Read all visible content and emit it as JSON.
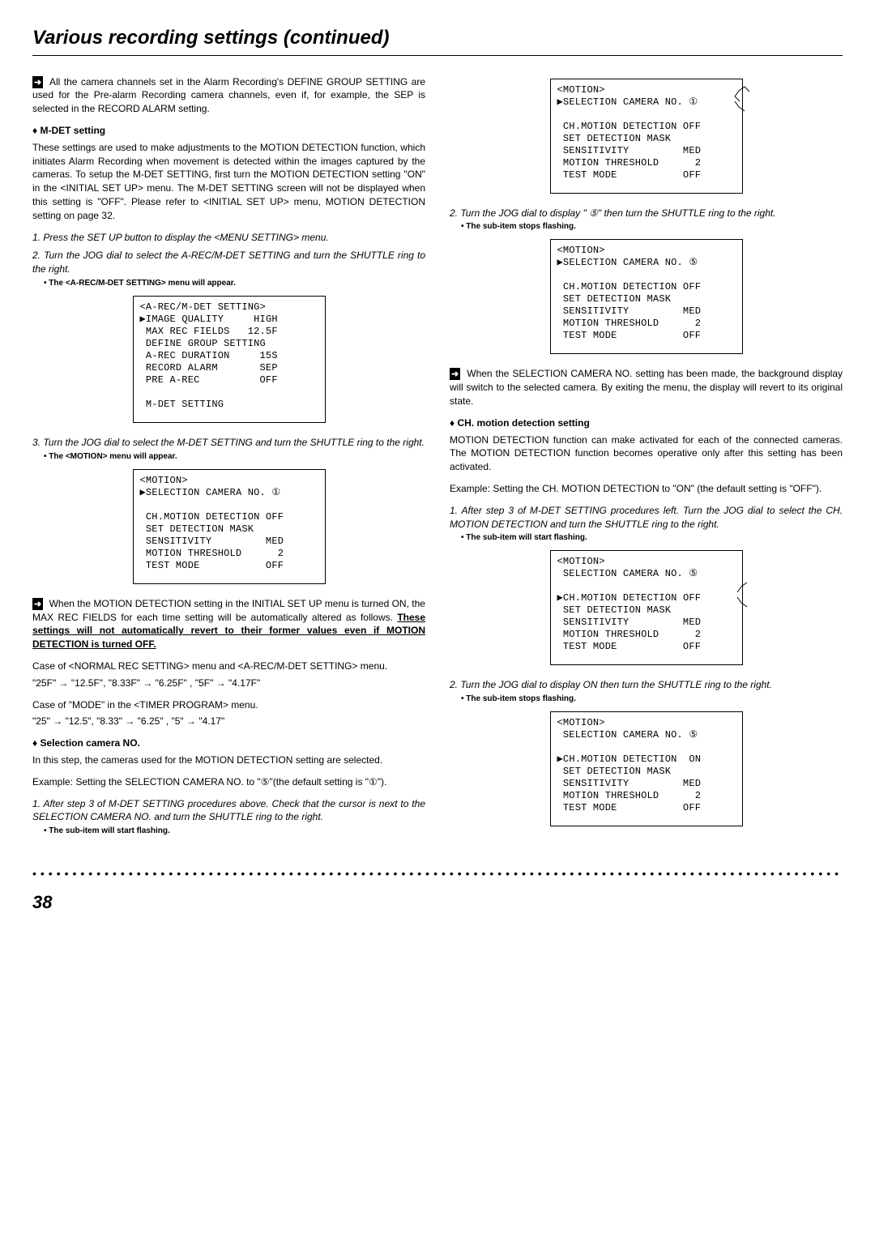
{
  "page_title": "Various recording settings (continued)",
  "page_number": "38",
  "left": {
    "notice1": "All the camera channels set in the Alarm Recording's DEFINE GROUP SETTING are used for the Pre-alarm Recording camera channels, even if, for example, the SEP is selected in the RECORD ALARM setting.",
    "h_mdet": "M-DET setting",
    "mdet_body": "These settings are used to make adjustments to the MOTION DETECTION function, which initiates Alarm Recording when movement is detected within the images captured by the cameras. To setup the M-DET SETTING, first turn the MOTION DETECTION setting \"ON\" in the <INITIAL SET UP> menu. The M-DET SETTING screen will not be displayed when this setting is \"OFF\". Please refer to <INITIAL SET UP> menu, MOTION DETECTION setting on page 32.",
    "step1": "1. Press the SET UP button to display the <MENU SETTING> menu.",
    "step2": "2. Turn the JOG dial to select the A-REC/M-DET SETTING and turn the SHUTTLE ring to the right.",
    "note2": "• The <A-REC/M-DET SETTING> menu will appear.",
    "screen1": "<A-REC/M-DET SETTING>\n▶IMAGE QUALITY     HIGH\n MAX REC FIELDS   12.5F\n DEFINE GROUP SETTING\n A-REC DURATION     15S\n RECORD ALARM       SEP\n PRE A-REC          OFF\n\n M-DET SETTING",
    "step3": "3. Turn the JOG dial to select the M-DET SETTING and turn the SHUTTLE ring to the right.",
    "note3": "• The <MOTION> menu will appear.",
    "screen2": "<MOTION>\n▶SELECTION CAMERA NO. ①\n\n CH.MOTION DETECTION OFF\n SET DETECTION MASK\n SENSITIVITY         MED\n MOTION THRESHOLD      2\n TEST MODE           OFF",
    "notice2_p1": "When the MOTION DETECTION setting in the INITIAL SET UP menu is turned ON, the MAX REC FIELDS for each time setting will be automatically altered as follows. ",
    "notice2_bold": "These settings will not automatically revert to their former values even if MOTION DETECTION is turned OFF.",
    "case1_title": "Case of <NORMAL REC SETTING> menu and <A-REC/M-DET SETTING> menu.",
    "case1_vals": "\"25F\" → \"12.5F\", \"8.33F\" → \"6.25F\" , \"5F\" → \"4.17F\"",
    "case2_title": "Case of \"MODE\" in the <TIMER PROGRAM> menu.",
    "case2_vals": "\"25\" → \"12.5\", \"8.33\" → \"6.25\" , \"5\" → \"4.17\"",
    "h_selcam": "Selection camera NO.",
    "selcam_body": "In this step, the cameras used for the MOTION DETECTION setting are selected.",
    "selcam_example": "Example: Setting the SELECTION CAMERA NO. to \"⑤\"(the default setting is \"①\").",
    "selcam_step1": "1. After step 3 of M-DET SETTING procedures above. Check that the cursor is next to the SELECTION CAMERA NO. and turn the SHUTTLE ring to the right.",
    "selcam_note1": "• The sub-item will start flashing."
  },
  "right": {
    "screen1": "<MOTION>\n▶SELECTION CAMERA NO. ①\n\n CH.MOTION DETECTION OFF\n SET DETECTION MASK\n SENSITIVITY         MED\n MOTION THRESHOLD      2\n TEST MODE           OFF",
    "step2": "2. Turn the JOG dial to display \" ⑤\" then turn the SHUTTLE ring to the right.",
    "note2": "• The sub-item stops flashing.",
    "screen2": "<MOTION>\n▶SELECTION CAMERA NO. ⑤\n\n CH.MOTION DETECTION OFF\n SET DETECTION MASK\n SENSITIVITY         MED\n MOTION THRESHOLD      2\n TEST MODE           OFF",
    "notice1": "When the SELECTION CAMERA NO. setting has been made, the background display will switch to the selected camera. By exiting the menu, the display will revert to its original state.",
    "h_chmot": "CH. motion detection setting",
    "chmot_body": "MOTION DETECTION function can make activated for each of the connected cameras. The MOTION DETECTION function becomes operative only after this setting has been activated.",
    "chmot_example": "Example: Setting the CH. MOTION DETECTION  to \"ON\" (the default setting is \"OFF\").",
    "chmot_step1": "1. After step 3 of M-DET SETTING procedures left. Turn the JOG dial to select the CH. MOTION DETECTION and turn the SHUTTLE ring to the right.",
    "chmot_note1": "• The sub-item will start flashing.",
    "screen3": "<MOTION>\n SELECTION CAMERA NO. ⑤\n\n▶CH.MOTION DETECTION OFF\n SET DETECTION MASK\n SENSITIVITY         MED\n MOTION THRESHOLD      2\n TEST MODE           OFF",
    "chmot_step2": "2. Turn the JOG dial to display ON then turn the SHUTTLE ring to the right.",
    "chmot_note2": "• The sub-item stops flashing.",
    "screen4": "<MOTION>\n SELECTION CAMERA NO. ⑤\n\n▶CH.MOTION DETECTION  ON\n SET DETECTION MASK\n SENSITIVITY         MED\n MOTION THRESHOLD      2\n TEST MODE           OFF"
  }
}
